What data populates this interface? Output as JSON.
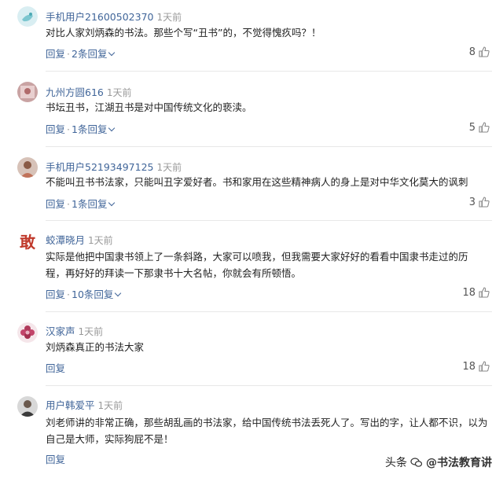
{
  "colors": {
    "link": "#406599",
    "time": "#999999",
    "text": "#222222"
  },
  "comments": [
    {
      "user": "手机用户21600502370",
      "time": "1天前",
      "text": "对比人家刘炳森的书法。那些个写“丑书”的，不觉得愧疚吗？！",
      "reply_label": "回复",
      "replies_label": "2条回复",
      "likes": "8",
      "avatar_icon": "default-avatar-icon"
    },
    {
      "user": "九州方圆616",
      "time": "1天前",
      "text": "书坛丑书，江湖丑书是对中国传统文化的亵渎。",
      "reply_label": "回复",
      "replies_label": "1条回复",
      "likes": "5",
      "avatar_icon": "user-photo-avatar"
    },
    {
      "user": "手机用户52193497125",
      "time": "1天前",
      "text": "不能叫丑书书法家，只能叫丑字爱好者。书和家用在这些精神病人的身上是对中华文化莫大的讽刺",
      "reply_label": "回复",
      "replies_label": "1条回复",
      "likes": "3",
      "avatar_icon": "user-photo-avatar"
    },
    {
      "user": "蛟潭晓月",
      "time": "1天前",
      "text": "实际是他把中国隶书领上了一条斜路，大家可以喷我，但我需要大家好好的看看中国隶书走过的历程，再好好的拜读一下那隶书十大名帖，你就会有所顿悟。",
      "reply_label": "回复",
      "replies_label": "10条回复",
      "likes": "18",
      "avatar_icon": "calligraphy-avatar",
      "avatar_char": "敢"
    },
    {
      "user": "汉家声",
      "time": "1天前",
      "text": "刘炳森真正的书法大家",
      "reply_label": "回复",
      "replies_label": "",
      "likes": "18",
      "avatar_icon": "flower-avatar"
    },
    {
      "user": "用户韩爱平",
      "time": "1天前",
      "text": "刘老师讲的非常正确，那些胡乱画的书法家，给中国传统书法丢死人了。写出的字，让人都不识，以为自己是大师，实际狗屁不是！",
      "reply_label": "回复",
      "replies_label": "",
      "likes": "",
      "avatar_icon": "user-photo-avatar"
    }
  ],
  "watermark": {
    "prefix": "头条",
    "handle": "@书法教育讲"
  }
}
